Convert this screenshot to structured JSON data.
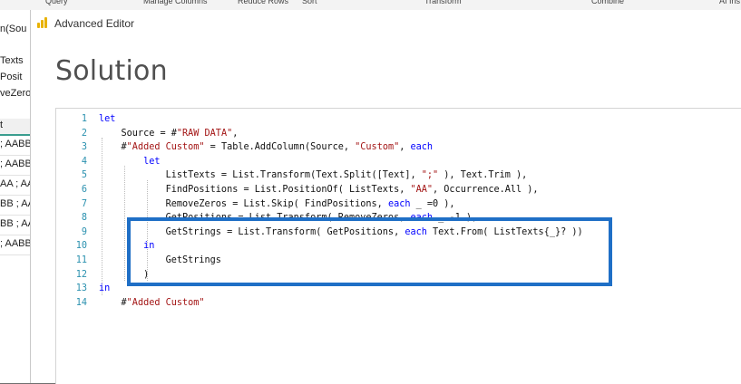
{
  "ribbon": {
    "items": [
      "Query",
      "Manage Columns",
      "Reduce Rows",
      "Sort",
      "Transform",
      "Combine",
      "AI Ins"
    ]
  },
  "left_pane": {
    "texts": [
      "n(Sou",
      "Texts",
      "Posit",
      "veZero"
    ],
    "header": "t",
    "rows": [
      "; AABB",
      "; AABB",
      "AA ; AA",
      "BB ; AA",
      "BB ; AA",
      "; AABB"
    ]
  },
  "dialog": {
    "title": "Advanced Editor",
    "heading": "Solution",
    "code_lines": [
      {
        "num": "1",
        "tokens": [
          {
            "k": "kw",
            "t": "let"
          }
        ]
      },
      {
        "num": "2",
        "tokens": [
          {
            "k": "",
            "t": "    Source = #"
          },
          {
            "k": "str",
            "t": "\"RAW DATA\""
          },
          {
            "k": "",
            "t": ","
          }
        ]
      },
      {
        "num": "3",
        "tokens": [
          {
            "k": "",
            "t": "    #"
          },
          {
            "k": "str",
            "t": "\"Added Custom\""
          },
          {
            "k": "",
            "t": " = Table.AddColumn(Source, "
          },
          {
            "k": "str",
            "t": "\"Custom\""
          },
          {
            "k": "",
            "t": ", "
          },
          {
            "k": "kw",
            "t": "each"
          }
        ]
      },
      {
        "num": "4",
        "tokens": [
          {
            "k": "",
            "t": "        "
          },
          {
            "k": "kw",
            "t": "let"
          }
        ]
      },
      {
        "num": "5",
        "tokens": [
          {
            "k": "",
            "t": "            ListTexts = List.Transform(Text.Split([Text], "
          },
          {
            "k": "str",
            "t": "\";\""
          },
          {
            "k": "",
            "t": " ), Text.Trim ),"
          }
        ]
      },
      {
        "num": "6",
        "tokens": [
          {
            "k": "",
            "t": "            FindPositions = List.PositionOf( ListTexts, "
          },
          {
            "k": "str",
            "t": "\"AA\""
          },
          {
            "k": "",
            "t": ", Occurrence.All ),"
          }
        ]
      },
      {
        "num": "7",
        "tokens": [
          {
            "k": "",
            "t": "            RemoveZeros = List.Skip( FindPositions, "
          },
          {
            "k": "kw",
            "t": "each"
          },
          {
            "k": "",
            "t": " _ =0 ),"
          }
        ]
      },
      {
        "num": "8",
        "tokens": [
          {
            "k": "",
            "t": "            GetPositions = List.Transform( RemoveZeros, "
          },
          {
            "k": "kw",
            "t": "each"
          },
          {
            "k": "",
            "t": " _ -1 ),"
          }
        ]
      },
      {
        "num": "9",
        "tokens": [
          {
            "k": "",
            "t": "            GetStrings = List.Transform( GetPositions, "
          },
          {
            "k": "kw",
            "t": "each"
          },
          {
            "k": "",
            "t": " Text.From( ListTexts{_}? ))"
          }
        ]
      },
      {
        "num": "10",
        "tokens": [
          {
            "k": "",
            "t": "        "
          },
          {
            "k": "kw",
            "t": "in"
          }
        ]
      },
      {
        "num": "11",
        "tokens": [
          {
            "k": "",
            "t": "            GetStrings"
          }
        ]
      },
      {
        "num": "12",
        "tokens": [
          {
            "k": "",
            "t": "        )"
          }
        ]
      },
      {
        "num": "13",
        "tokens": [
          {
            "k": "kw",
            "t": "in"
          }
        ]
      },
      {
        "num": "14",
        "tokens": [
          {
            "k": "",
            "t": "    #"
          },
          {
            "k": "str",
            "t": "\"Added Custom\""
          }
        ]
      }
    ]
  },
  "colors": {
    "keyword": "#0000ff",
    "string": "#a31515",
    "line_number": "#2b91af",
    "highlight_box": "#1f6fc6",
    "icon_yellow": "#e8b200"
  },
  "icons": {
    "app": "power-bi-icon"
  }
}
